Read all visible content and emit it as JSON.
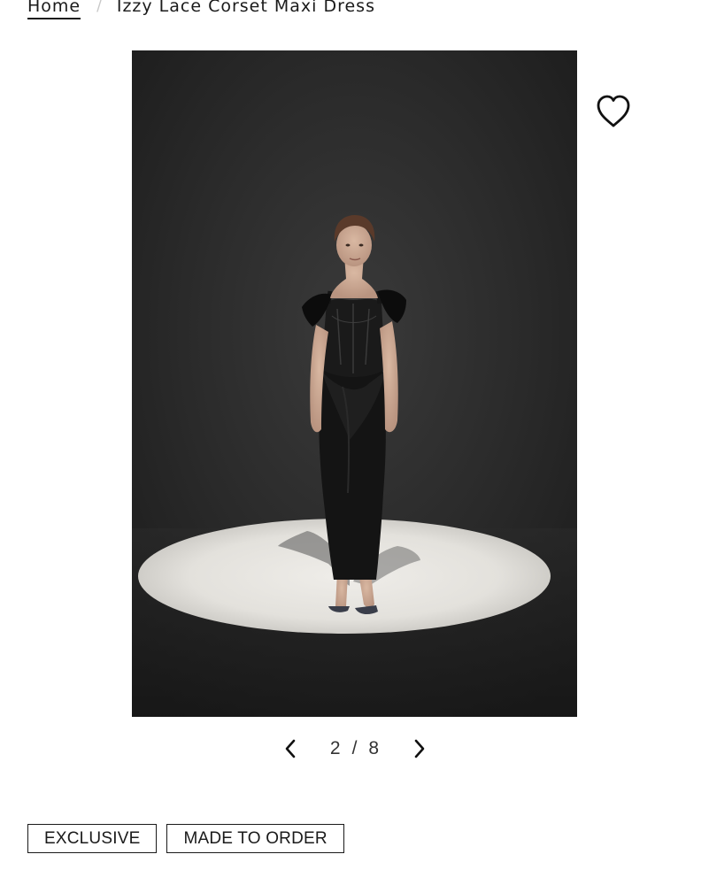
{
  "breadcrumb": {
    "home_label": "Home",
    "separator": "/",
    "current_label": "Izzy Lace Corset Maxi Dress"
  },
  "product": {
    "image_icon": "product-photo",
    "wishlist_icon": "heart-outline-icon"
  },
  "pager": {
    "current": "2",
    "separator": "/",
    "total": "8",
    "prev_icon": "chevron-left-icon",
    "next_icon": "chevron-right-icon"
  },
  "badges": [
    {
      "label": "EXCLUSIVE"
    },
    {
      "label": "MADE TO ORDER"
    }
  ],
  "colors": {
    "text": "#1a1a1a",
    "photo_background": "#2a2a2a",
    "spotlight": "#e8e6e2",
    "separator": "#c8c8c8"
  }
}
